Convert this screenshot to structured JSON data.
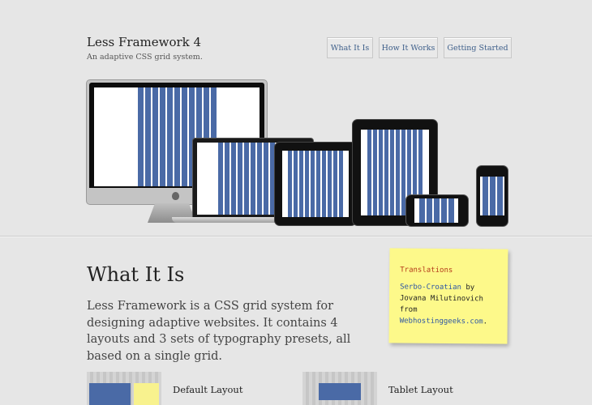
{
  "header": {
    "title": "Less Framework 4",
    "tagline": "An adaptive CSS grid system."
  },
  "nav": {
    "items": [
      {
        "label": "What It Is"
      },
      {
        "label": "How It Works"
      },
      {
        "label": "Getting Started"
      }
    ]
  },
  "hero": {
    "devices": [
      "imac",
      "macbook",
      "ipad-landscape",
      "ipad-portrait",
      "iphone-landscape",
      "iphone-portrait"
    ]
  },
  "main": {
    "heading": "What It Is",
    "intro": "Less Framework is a CSS grid system for designing adaptive websites. It contains 4 layouts and 3 sets of typography presets, all based on a single grid."
  },
  "note": {
    "title": "Translations",
    "link1": "Serbo-Croatian",
    "text1": " by Jovana Milutinovich from ",
    "link2": "Webhostinggeeks.com",
    "text2": "."
  },
  "layouts": [
    {
      "label": "Default Layout"
    },
    {
      "label": "Tablet Layout"
    }
  ],
  "colors": {
    "background": "#e6e6e6",
    "grid_blue": "#4a6aa6",
    "link_blue": "#3e5f8a",
    "note_yellow": "#fdf98a"
  }
}
